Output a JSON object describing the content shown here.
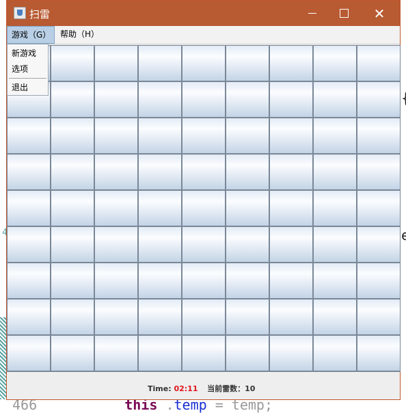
{
  "window": {
    "title": "扫雷"
  },
  "menubar": {
    "game": "游戏（G）",
    "help": "帮助（H）"
  },
  "game_menu": {
    "new_game": "新游戏",
    "options": "选项",
    "exit": "退出"
  },
  "status": {
    "time_label": "Time:",
    "time_value": "02:11",
    "mines_label": "当前雷数：",
    "mines_value": "10"
  },
  "board": {
    "rows": 9,
    "cols": 9
  },
  "background": {
    "line_number": "466",
    "keyword": "this",
    "field": "temp",
    "op": " = ",
    "value": "temp;",
    "brace": "{",
    "char": "e",
    "mark": "4"
  }
}
